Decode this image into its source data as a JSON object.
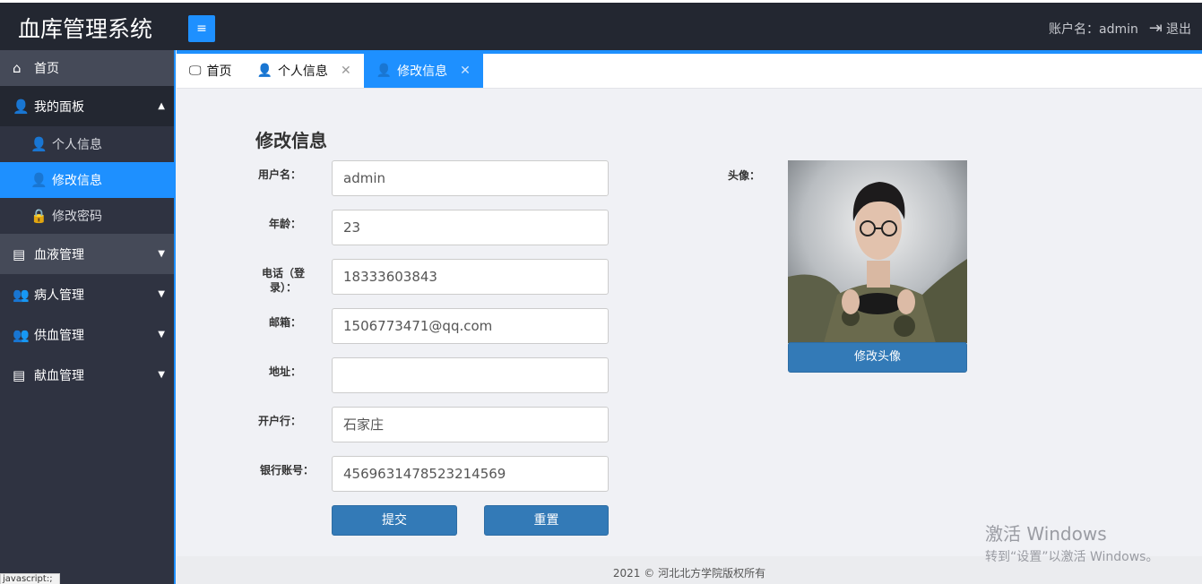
{
  "app": {
    "title": "血库管理系统",
    "menu_toggle": "≡"
  },
  "header": {
    "account_label": "账户名：admin",
    "logout_label": "退出"
  },
  "sidebar": {
    "home": "首页",
    "my_panel": "我的面板",
    "sub_items": [
      "个人信息",
      "修改信息",
      "修改密码"
    ],
    "blood": "血液管理",
    "patient": "病人管理",
    "supply": "供血管理",
    "donate": "献血管理"
  },
  "tabs": [
    "首页",
    "个人信息",
    "修改信息"
  ],
  "form": {
    "title": "修改信息",
    "fields": [
      {
        "label": "用户名：",
        "value": "admin"
      },
      {
        "label": "年龄：",
        "value": "23"
      },
      {
        "label": "电话（登录）：",
        "value": "18333603843"
      },
      {
        "label": "邮箱：",
        "value": "1506773471@qq.com"
      },
      {
        "label": "地址：",
        "value": ""
      },
      {
        "label": "开户行：",
        "value": "石家庄"
      },
      {
        "label": "银行账号：",
        "value": "4569631478523214569"
      }
    ],
    "submit": "提交",
    "reset": "重置"
  },
  "avatar": {
    "label": "头像：",
    "button": "修改头像"
  },
  "footer": "2021 © 河北北方学院版权所有",
  "watermark": {
    "line1": "激活 Windows",
    "line2": "转到“设置”以激活 Windows。"
  },
  "statusbar": "javascript:;",
  "colors": {
    "accent": "#1e90ff",
    "topbar": "#232731",
    "sidebar": "#2f3341",
    "button": "#337ab7"
  }
}
